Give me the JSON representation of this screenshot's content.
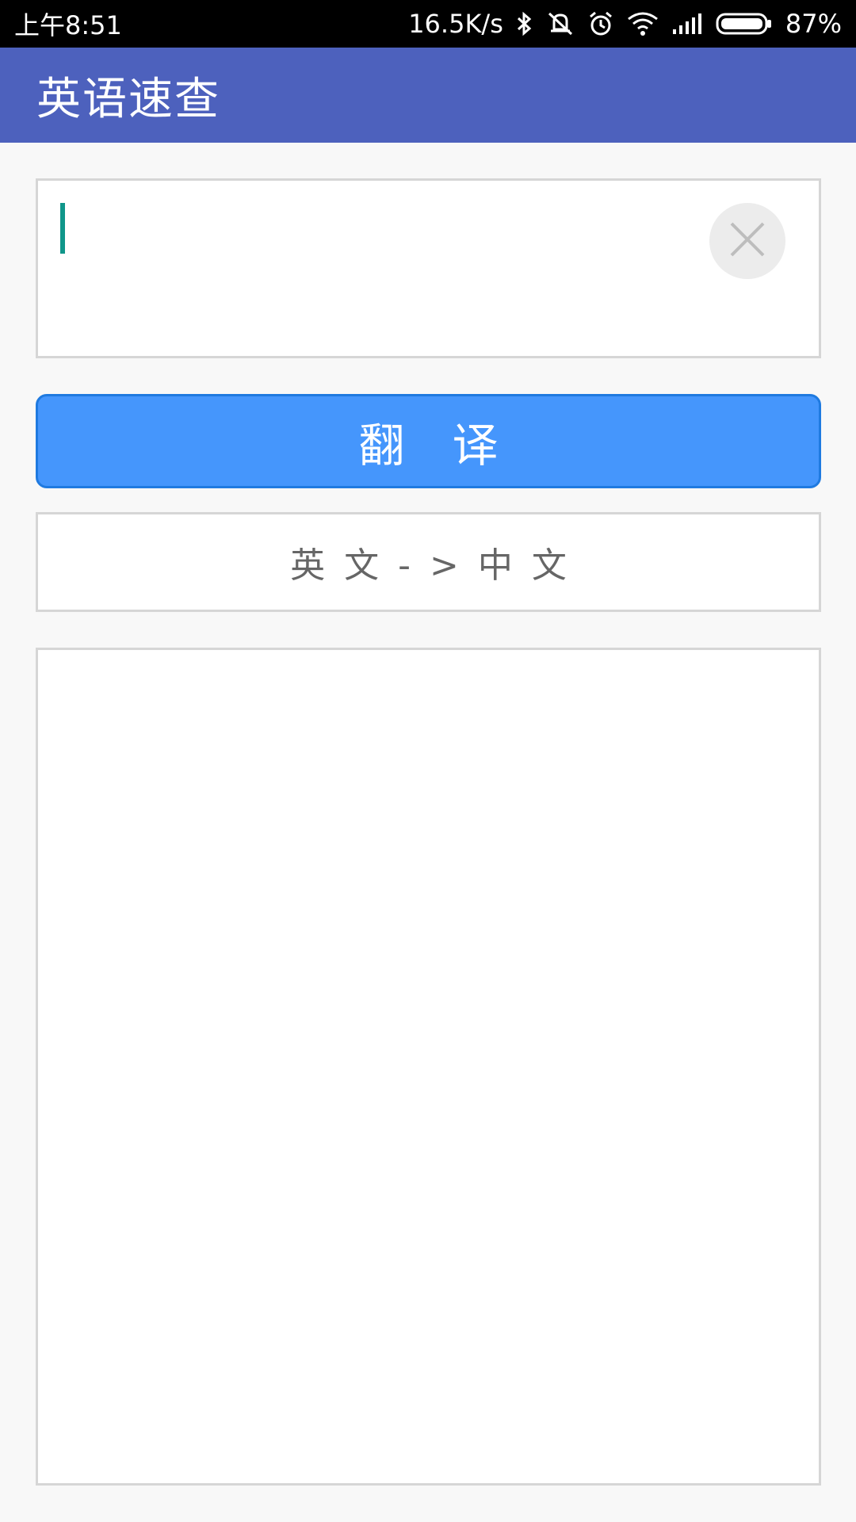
{
  "status_bar": {
    "time": "上午8:51",
    "net_speed": "16.5K/s",
    "battery": "87%"
  },
  "app_bar": {
    "title": "英语速查"
  },
  "input": {
    "value": "",
    "clear_icon": "close-icon"
  },
  "translate_button": {
    "label": "翻译"
  },
  "direction": {
    "label": "英文->中文"
  },
  "result": {
    "text": ""
  },
  "colors": {
    "app_bar": "#4d61bd",
    "button": "#4596fc",
    "cursor": "#10968a"
  }
}
